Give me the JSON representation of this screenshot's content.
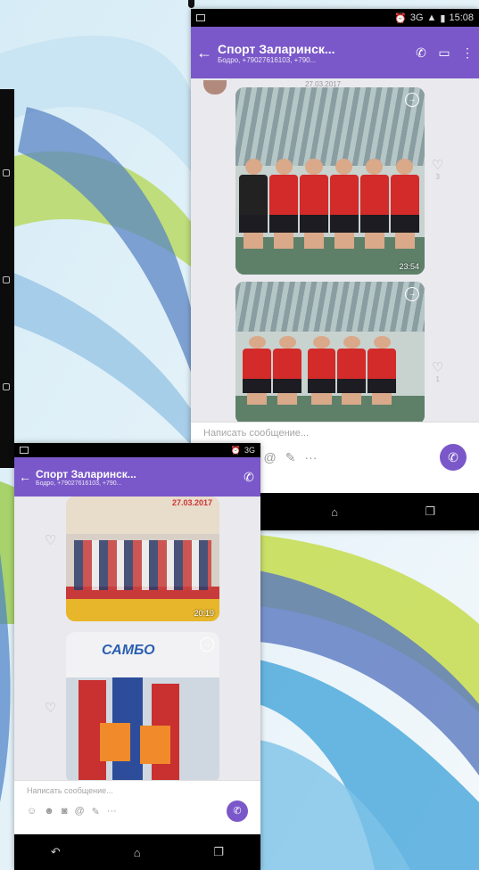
{
  "colors": {
    "viber_purple": "#7a58c9",
    "chat_bg": "#e9e9ee",
    "status_black": "#000000"
  },
  "main_phone": {
    "status": {
      "signal_text": "3G",
      "time": "15:08"
    },
    "header": {
      "back_icon": "arrow-left-icon",
      "title": "Спорт Заларинск...",
      "subtitle": "Бодро, +79027616103, +790...",
      "call_icon": "phone-icon",
      "video_icon": "video-icon",
      "menu_icon": "more-vertical-icon"
    },
    "date_chip": "27.03.2017",
    "messages": [
      {
        "type": "photo",
        "time": "23:54",
        "likes": "3"
      },
      {
        "type": "photo",
        "time": "",
        "likes": "1"
      }
    ],
    "composer": {
      "placeholder": "Написать сообщение...",
      "icons": [
        "sticker-icon",
        "emoji-icon",
        "camera-icon",
        "at-icon",
        "doodle-icon",
        "more-icon"
      ],
      "send_icon": "viber-send-icon"
    },
    "nav": [
      "back-nav-icon",
      "home-nav-icon",
      "recent-apps-icon"
    ]
  },
  "second_phone": {
    "status": {
      "signal_text": "3G"
    },
    "header": {
      "back_icon": "arrow-left-icon",
      "title": "Спорт Заларинск...",
      "subtitle": "Бодро, +79027616103, +790...",
      "call_icon": "phone-icon"
    },
    "messages": [
      {
        "type": "photo",
        "caption": "27.03.2017",
        "time": "20:19"
      },
      {
        "type": "photo",
        "caption": "САМБО",
        "time": ""
      }
    ],
    "composer": {
      "placeholder": "Написать сообщение...",
      "icons": [
        "sticker-icon",
        "emoji-icon",
        "camera-icon",
        "at-icon",
        "doodle-icon",
        "more-icon"
      ],
      "send_icon": "viber-send-icon"
    },
    "nav": [
      "back-nav-icon",
      "home-nav-icon",
      "recent-apps-icon"
    ]
  }
}
